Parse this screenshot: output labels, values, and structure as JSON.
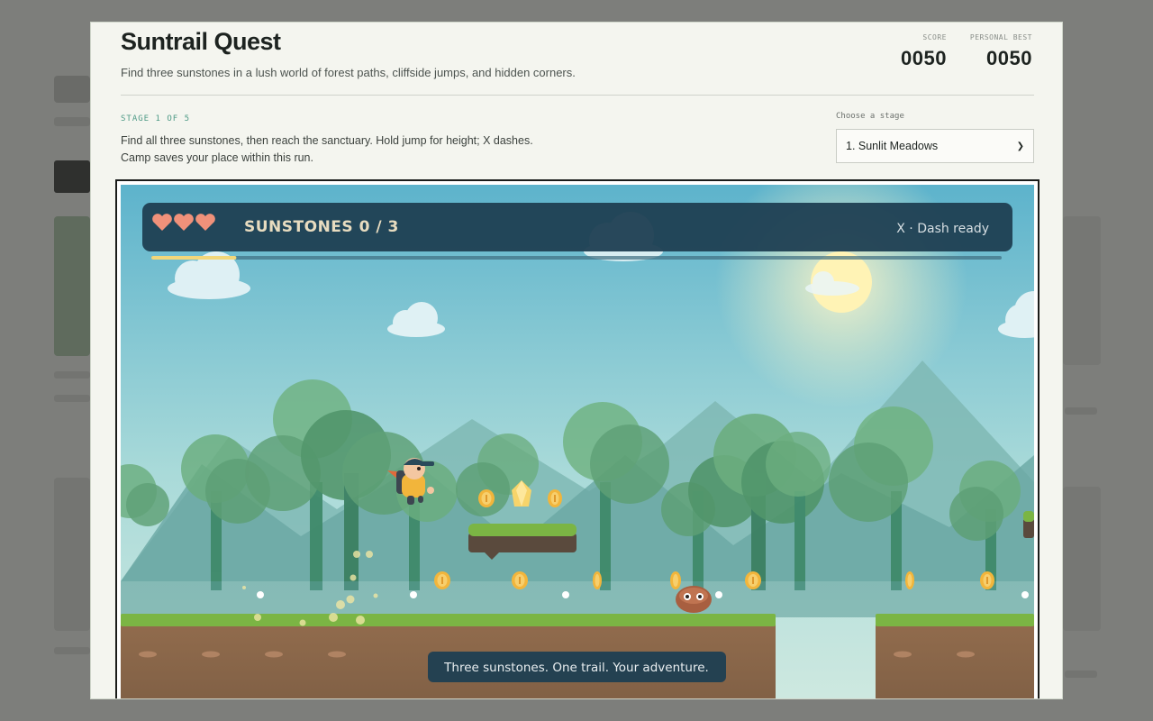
{
  "game": {
    "title": "Suntrail Quest",
    "subtitle": "Find three sunstones in a lush world of forest paths, cliffside jumps, and hidden corners.",
    "score_label": "SCORE",
    "score": "0050",
    "best_label": "PERSONAL BEST",
    "best": "0050"
  },
  "stage": {
    "label": "STAGE 1 OF 5",
    "description": "Find all three sunstones, then reach the sanctuary. Hold jump for height; X dashes. Camp saves your place within this run.",
    "choose_label": "Choose a stage",
    "selected": "1. Sunlit Meadows"
  },
  "hud": {
    "sunstones_text": "SUNSTONES 0 / 3",
    "dash_text": "X · Dash ready",
    "hearts": 3,
    "progress": 0.1
  },
  "banner": {
    "text": "Three sunstones. One trail. Your adventure."
  },
  "colors": {
    "sky_top": "#5fb4cc",
    "hud_bg": "#1f3f52",
    "heart": "#f0917a",
    "grass": "#7bb544",
    "dirt": "#8b6a4c",
    "coin": "#f2b53b",
    "accent": "#4e9a86"
  }
}
